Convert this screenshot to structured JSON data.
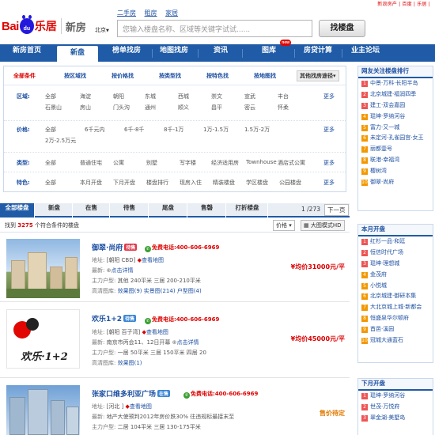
{
  "header": {
    "top_links": "新浪房产 | 百度 | 乐居 |",
    "logo_baidu": "Bai",
    "logo_paw": "du",
    "logo_leju": "乐居",
    "logo_product": "新房",
    "city": "北京",
    "quick_links": [
      "二手房",
      "租房",
      "家居"
    ],
    "search_placeholder": "您输入楼盘名称、区域等关键字试试......",
    "search_button": "找楼盘"
  },
  "nav": {
    "items": [
      "新房首页",
      "新盘",
      "榜单找房",
      "地图找房",
      "资讯",
      "图库",
      "房贷计算",
      "业主论坛"
    ],
    "badge": "new"
  },
  "filter": {
    "tabs": [
      "全部条件",
      "按区域找",
      "按价格找",
      "按类型找",
      "按特色找",
      "按地图找",
      "其他找房途径"
    ],
    "sort_arrow": "▾",
    "more": "更多",
    "rows": {
      "region": {
        "label": "区域:",
        "line1": [
          "全部",
          "海淀",
          "朝阳",
          "东城",
          "西城",
          "崇文",
          "宣武",
          "丰台"
        ],
        "line2": [
          "石景山",
          "房山",
          "门头沟",
          "通州",
          "顺义",
          "昌平",
          "密云",
          "怀柔"
        ]
      },
      "price": {
        "label": "价格:",
        "line1": [
          "全部",
          "6千元内",
          "6千-8千",
          "8千-1万",
          "1万-1.5万",
          "1.5万-2万"
        ],
        "line2": [
          "2万-2.5万元"
        ]
      },
      "type": {
        "label": "类型:",
        "line1": [
          "全部",
          "普通住宅",
          "公寓",
          "别墅",
          "写字楼",
          "经济适用房",
          "Townhouse",
          "酒店式公寓"
        ]
      },
      "feature": {
        "label": "特色:",
        "line1": [
          "全部",
          "本月开盘",
          "下月开盘",
          "楼盘排行",
          "现房入住",
          "精装楼盘",
          "学区楼盘",
          "公园楼盘"
        ]
      }
    }
  },
  "list": {
    "tabs": [
      "全部楼盘",
      "新盘",
      "在售",
      "待售",
      "尾盘",
      "售磬",
      "打折楼盘"
    ],
    "page": "1 /273",
    "next": "下一页",
    "found_prefix": "找到",
    "found_count": "3275",
    "found_suffix": "个符合条件的楼盘",
    "sort": "价格 ▾",
    "view": "大图模式HD",
    "label_address": "地址:",
    "label_latest": "最新:",
    "label_layout": "主力户型:",
    "label_pics": "高清图库:",
    "phone_prefix": "免费电话:",
    "map_link": "查看地图",
    "detail_link": "点击详情",
    "items": [
      {
        "name": "御翠·尚府",
        "tag": "待售",
        "tag_color": "#e0394b",
        "phone": "400-606-6969",
        "address": "[朝阳 CBD]",
        "layout": "其他 240平米 三居 200-210平米",
        "pics": [
          "效果图(9)",
          "实景图(214)",
          "户型图(4)"
        ],
        "price": "¥均价31000元/平"
      },
      {
        "name": "欢乐1+2",
        "tag": "待售",
        "tag_color": "#3a86d4",
        "phone": "400-606-6969",
        "address": "[朝阳 百子湾]",
        "latest": "南京市丙会11、12日开幕",
        "layout": "一居 50平米 三居 150平米 四居 20",
        "pics": [
          "效果图(1)"
        ],
        "price": "¥均价45000元/平",
        "logo_text": "欢乐·1+2"
      },
      {
        "name": "张家口维多利亚广场",
        "tag": "在售",
        "tag_color": "#3a86d4",
        "phone": "400-606-6969",
        "address": "[河北 ]",
        "latest": "地产大使预判2012年房价跌30% 往违规标最接末至",
        "layout": "二居 104平米 三居 130-175平米",
        "price": "售价待定"
      }
    ]
  },
  "sidebar": {
    "hot": {
      "title": "网友关注楼盘排行",
      "items": [
        "中景·万科·长阳半岛",
        "北京城建·福润四季",
        "建工·双会嘉园",
        "琨坤·罗纳河谷",
        "富力·又一城",
        "未定河·孔雀园宫·女王",
        "丽都壹号",
        "联港·幸福湾",
        "樱树湾",
        "御翠·尚府"
      ]
    },
    "thismonth": {
      "title": "本月开盘",
      "items": [
        "红杉一品·和廷",
        "恒信时代广场",
        "琨坤·理想城",
        "金茂府",
        "小悦城",
        "北京城建·御研本集",
        "大北京城上城·新都会",
        "恒盛泉华尔顿府",
        "首邑·溪园",
        "冠城大通蓝石"
      ]
    },
    "nextmonth": {
      "title": "下月开盘",
      "items": [
        "琨坤·罗纳河谷",
        "世茂·万悦府",
        "翠金湖·美墅岛"
      ]
    }
  },
  "colors": {
    "brand_blue": "#1f5ba6",
    "accent_red": "#d00",
    "link_blue": "#1e50a2"
  }
}
